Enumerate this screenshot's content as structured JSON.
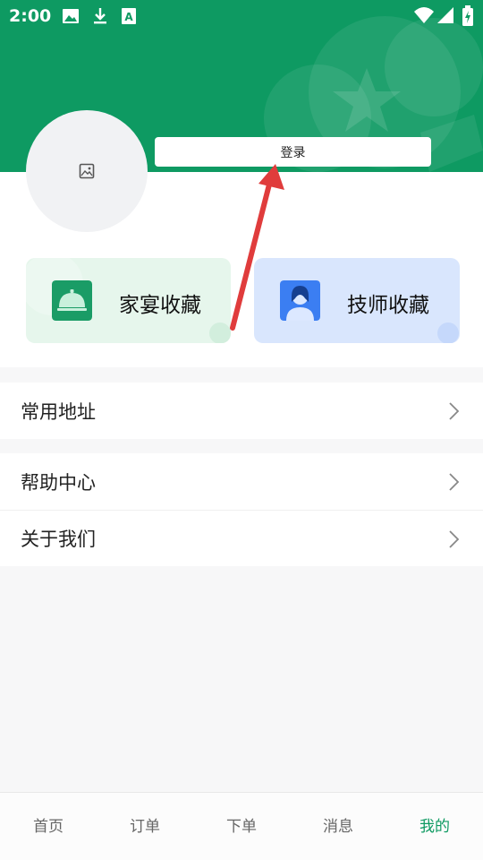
{
  "status_bar": {
    "time": "2:00",
    "icons": [
      "image-icon",
      "download-icon",
      "text-icon",
      "wifi-icon",
      "signal-icon",
      "battery-icon"
    ]
  },
  "profile": {
    "avatar_icon": "image-placeholder-icon",
    "login_label": "登录"
  },
  "favorites": [
    {
      "label": "家宴收藏",
      "icon": "cloche-icon"
    },
    {
      "label": "技师收藏",
      "icon": "technician-icon"
    }
  ],
  "menu_groups": [
    {
      "items": [
        {
          "label": "常用地址"
        }
      ]
    },
    {
      "items": [
        {
          "label": "帮助中心"
        },
        {
          "label": "关于我们"
        }
      ]
    }
  ],
  "tabs": [
    {
      "label": "首页",
      "active": false
    },
    {
      "label": "订单",
      "active": false
    },
    {
      "label": "下单",
      "active": false
    },
    {
      "label": "消息",
      "active": false
    },
    {
      "label": "我的",
      "active": true
    }
  ],
  "colors": {
    "header_green": "#0e9a62",
    "arrow_red": "#e03c3c",
    "active_tab": "#0e9a62"
  }
}
